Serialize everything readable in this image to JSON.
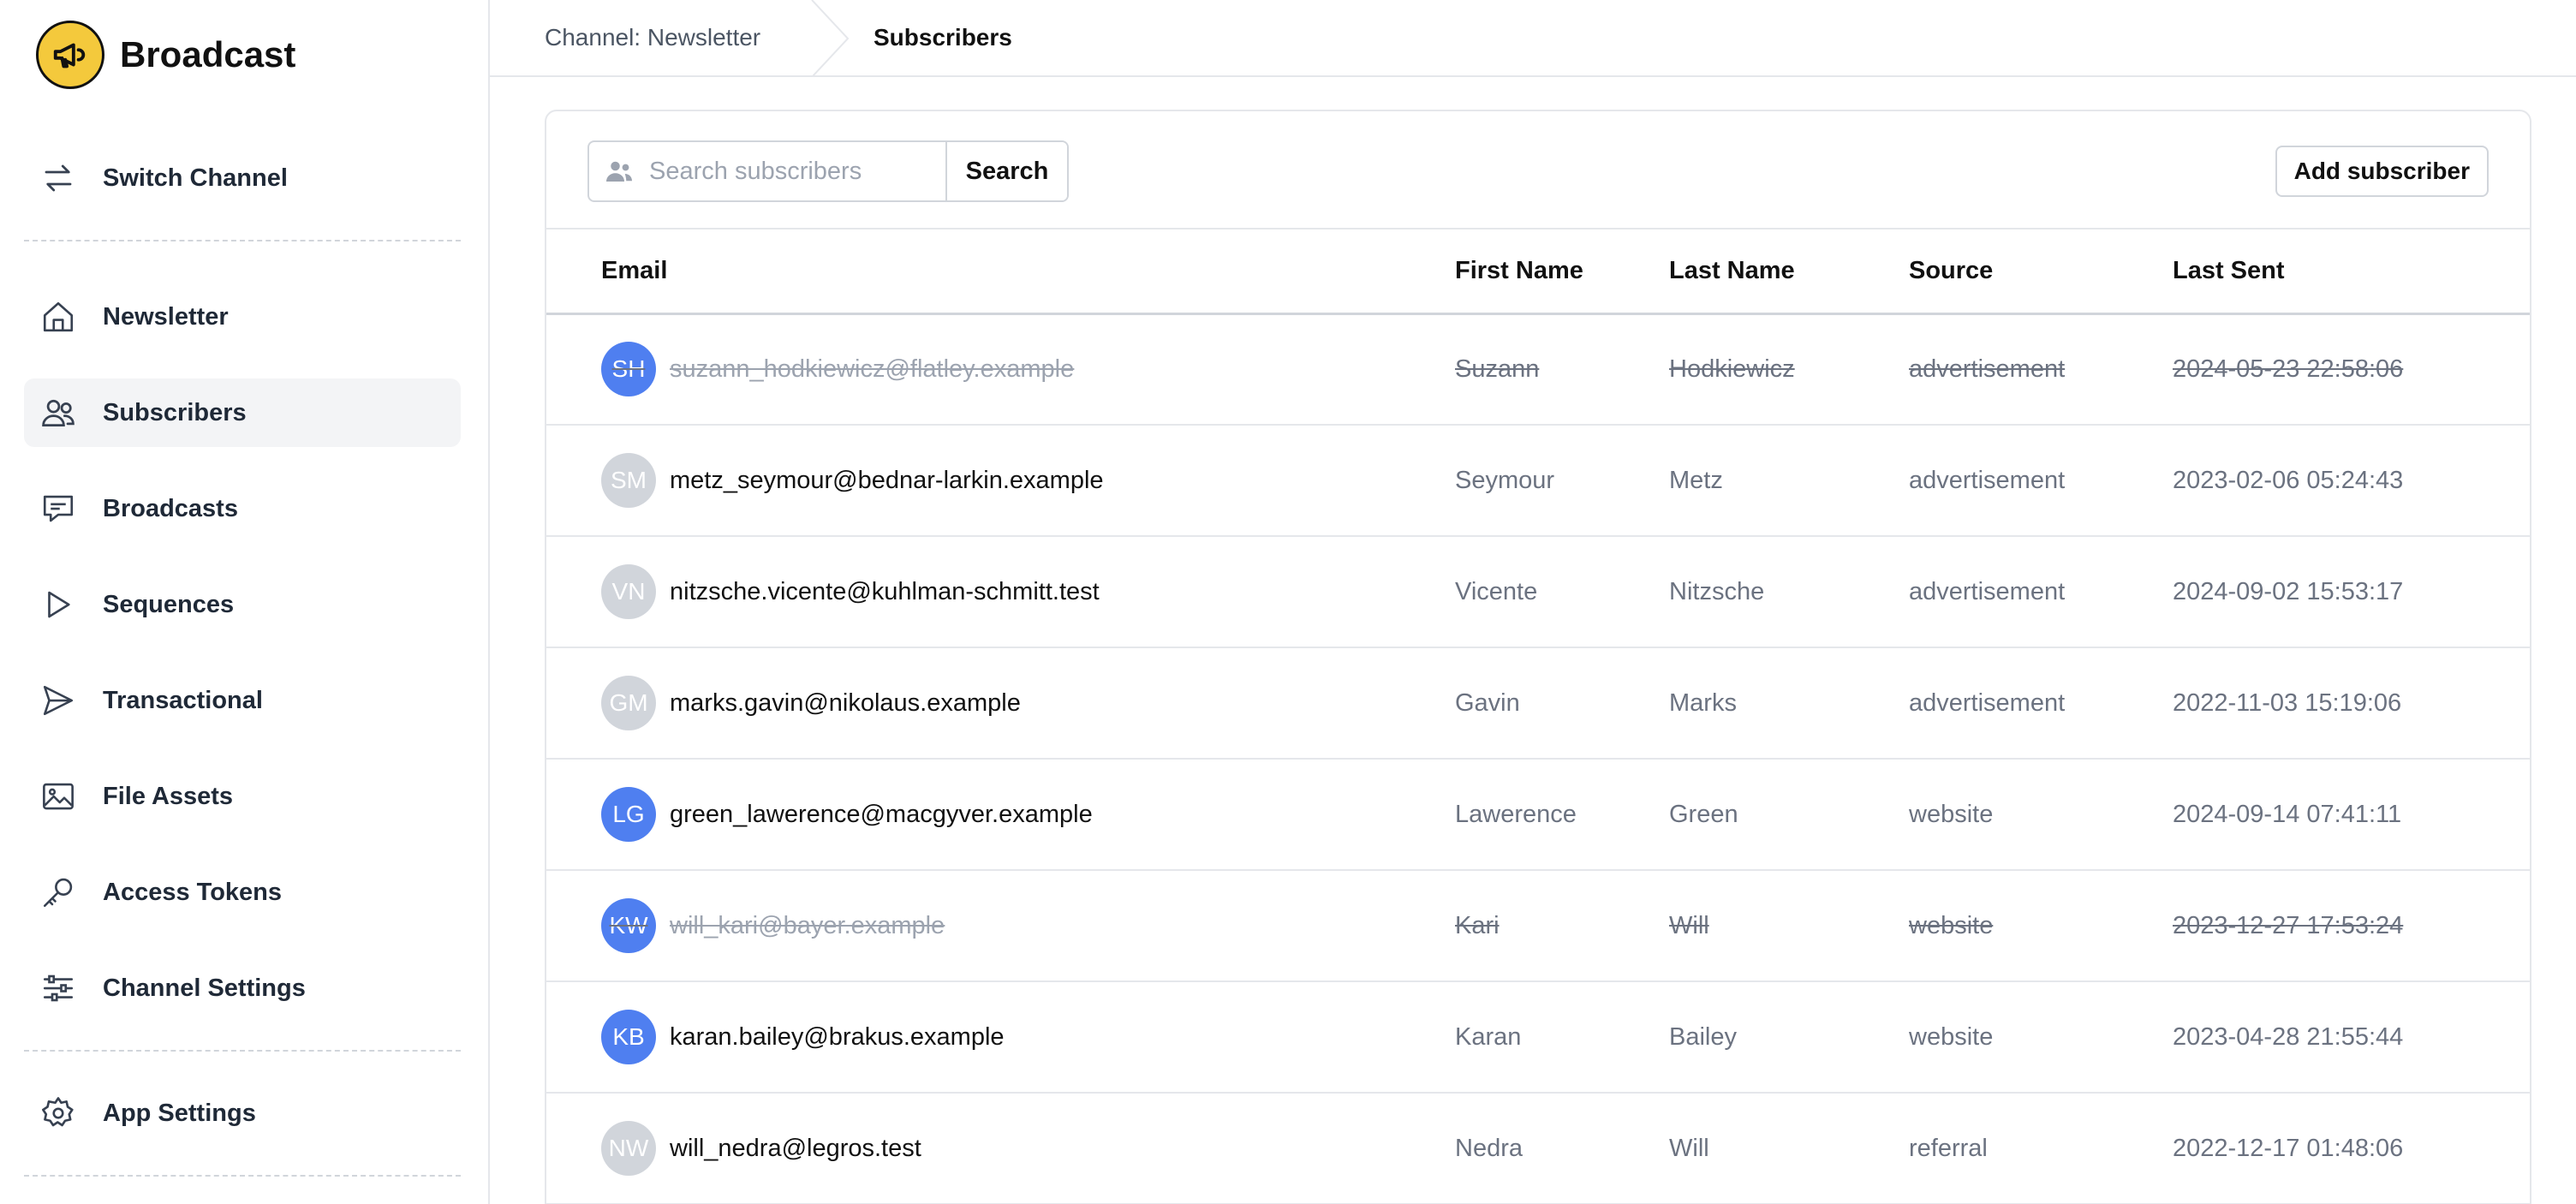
{
  "app": {
    "name": "Broadcast",
    "accent_color": "#f4c93c"
  },
  "sidebar": {
    "switch_channel": "Switch Channel",
    "items": [
      {
        "label": "Newsletter",
        "icon": "home-icon"
      },
      {
        "label": "Subscribers",
        "icon": "users-icon",
        "active": true
      },
      {
        "label": "Broadcasts",
        "icon": "chat-icon"
      },
      {
        "label": "Sequences",
        "icon": "play-icon"
      },
      {
        "label": "Transactional",
        "icon": "send-icon"
      },
      {
        "label": "File Assets",
        "icon": "image-icon"
      },
      {
        "label": "Access Tokens",
        "icon": "key-icon"
      },
      {
        "label": "Channel Settings",
        "icon": "sliders-icon"
      }
    ],
    "app_settings": "App Settings"
  },
  "breadcrumb": {
    "channel": "Channel: Newsletter",
    "current": "Subscribers"
  },
  "toolbar": {
    "search_placeholder": "Search subscribers",
    "search_label": "Search",
    "add_label": "Add subscriber"
  },
  "table": {
    "columns": [
      "Email",
      "First Name",
      "Last Name",
      "Source",
      "Last Sent"
    ],
    "rows": [
      {
        "initials": "SH",
        "email": "suzann_hodkiewicz@flatley.example",
        "first": "Suzann",
        "last": "Hodkiewicz",
        "source": "advertisement",
        "last_sent": "2024-05-23 22:58:06",
        "avatar_color": "#4f7ff0",
        "unsubscribed": true
      },
      {
        "initials": "SM",
        "email": "metz_seymour@bednar-larkin.example",
        "first": "Seymour",
        "last": "Metz",
        "source": "advertisement",
        "last_sent": "2023-02-06 05:24:43",
        "avatar_color": "#d1d5db",
        "unsubscribed": false
      },
      {
        "initials": "VN",
        "email": "nitzsche.vicente@kuhlman-schmitt.test",
        "first": "Vicente",
        "last": "Nitzsche",
        "source": "advertisement",
        "last_sent": "2024-09-02 15:53:17",
        "avatar_color": "#d1d5db",
        "unsubscribed": false
      },
      {
        "initials": "GM",
        "email": "marks.gavin@nikolaus.example",
        "first": "Gavin",
        "last": "Marks",
        "source": "advertisement",
        "last_sent": "2022-11-03 15:19:06",
        "avatar_color": "#d1d5db",
        "unsubscribed": false
      },
      {
        "initials": "LG",
        "email": "green_lawerence@macgyver.example",
        "first": "Lawerence",
        "last": "Green",
        "source": "website",
        "last_sent": "2024-09-14 07:41:11",
        "avatar_color": "#4f7ff0",
        "unsubscribed": false
      },
      {
        "initials": "KW",
        "email": "will_kari@bayer.example",
        "first": "Kari",
        "last": "Will",
        "source": "website",
        "last_sent": "2023-12-27 17:53:24",
        "avatar_color": "#4f7ff0",
        "unsubscribed": true
      },
      {
        "initials": "KB",
        "email": "karan.bailey@brakus.example",
        "first": "Karan",
        "last": "Bailey",
        "source": "website",
        "last_sent": "2023-04-28 21:55:44",
        "avatar_color": "#4f7ff0",
        "unsubscribed": false
      },
      {
        "initials": "NW",
        "email": "will_nedra@legros.test",
        "first": "Nedra",
        "last": "Will",
        "source": "referral",
        "last_sent": "2022-12-17 01:48:06",
        "avatar_color": "#d1d5db",
        "unsubscribed": false
      }
    ]
  }
}
